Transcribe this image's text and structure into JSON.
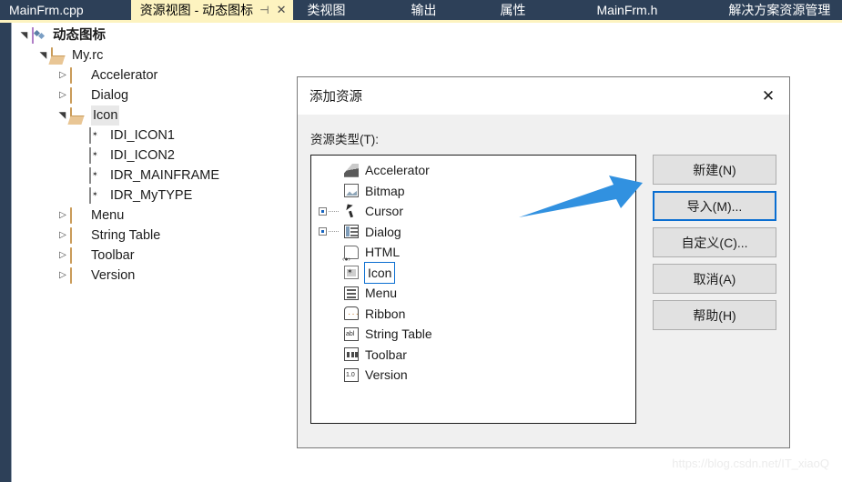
{
  "tabbar": {
    "tabs": [
      {
        "label": "MainFrm.cpp",
        "active": false
      },
      {
        "label": "资源视图 - 动态图标",
        "active": true
      },
      {
        "label": "类视图",
        "active": false
      },
      {
        "label": "输出",
        "active": false
      },
      {
        "label": "属性",
        "active": false
      },
      {
        "label": "MainFrm.h",
        "active": false
      },
      {
        "label": "解决方案资源管理",
        "active": false
      }
    ],
    "pin_glyph": "⊣",
    "close_glyph": "✕",
    "active_bg": "#fdf3c0",
    "bar_bg": "#2d4058"
  },
  "treeview": {
    "nodes": [
      {
        "label": "动态图标",
        "indent": 0,
        "twisty": "▲",
        "icon": "project-icon",
        "bold": true,
        "selected": false
      },
      {
        "label": "My.rc",
        "indent": 1,
        "twisty": "▲",
        "icon": "folder-open-icon",
        "bold": false,
        "selected": false
      },
      {
        "label": "Accelerator",
        "indent": 2,
        "twisty": "▷",
        "icon": "folder-icon",
        "bold": false,
        "selected": false
      },
      {
        "label": "Dialog",
        "indent": 2,
        "twisty": "▷",
        "icon": "folder-icon",
        "bold": false,
        "selected": false
      },
      {
        "label": "Icon",
        "indent": 2,
        "twisty": "▲",
        "icon": "folder-open-icon",
        "bold": false,
        "selected": true
      },
      {
        "label": "IDI_ICON1",
        "indent": 3,
        "twisty": "",
        "icon": "resource-file-icon",
        "bold": false,
        "selected": false
      },
      {
        "label": "IDI_ICON2",
        "indent": 3,
        "twisty": "",
        "icon": "resource-file-icon",
        "bold": false,
        "selected": false
      },
      {
        "label": "IDR_MAINFRAME",
        "indent": 3,
        "twisty": "",
        "icon": "resource-file-icon",
        "bold": false,
        "selected": false
      },
      {
        "label": "IDR_MyTYPE",
        "indent": 3,
        "twisty": "",
        "icon": "resource-file-icon",
        "bold": false,
        "selected": false
      },
      {
        "label": "Menu",
        "indent": 2,
        "twisty": "▷",
        "icon": "folder-icon",
        "bold": false,
        "selected": false
      },
      {
        "label": "String Table",
        "indent": 2,
        "twisty": "▷",
        "icon": "folder-icon",
        "bold": false,
        "selected": false
      },
      {
        "label": "Toolbar",
        "indent": 2,
        "twisty": "▷",
        "icon": "folder-icon",
        "bold": false,
        "selected": false
      },
      {
        "label": "Version",
        "indent": 2,
        "twisty": "▷",
        "icon": "folder-icon",
        "bold": false,
        "selected": false
      }
    ]
  },
  "dialog": {
    "title": "添加资源",
    "close_glyph": "✕",
    "list_label": "资源类型(T):",
    "items": [
      {
        "label": "Accelerator",
        "icon": "accelerator-icon",
        "expandable": false,
        "focused": false
      },
      {
        "label": "Bitmap",
        "icon": "bitmap-icon",
        "expandable": false,
        "focused": false
      },
      {
        "label": "Cursor",
        "icon": "cursor-icon",
        "expandable": true,
        "focused": false
      },
      {
        "label": "Dialog",
        "icon": "dialog-icon",
        "expandable": true,
        "focused": false
      },
      {
        "label": "HTML",
        "icon": "html-icon",
        "expandable": false,
        "focused": false
      },
      {
        "label": "Icon",
        "icon": "icon-icon",
        "expandable": false,
        "focused": true
      },
      {
        "label": "Menu",
        "icon": "menu-icon",
        "expandable": false,
        "focused": false
      },
      {
        "label": "Ribbon",
        "icon": "ribbon-icon",
        "expandable": false,
        "focused": false
      },
      {
        "label": "String Table",
        "icon": "string-table-icon",
        "expandable": false,
        "focused": false
      },
      {
        "label": "Toolbar",
        "icon": "toolbar-icon",
        "expandable": false,
        "focused": false
      },
      {
        "label": "Version",
        "icon": "version-icon",
        "expandable": false,
        "focused": false
      }
    ],
    "buttons": [
      {
        "label": "新建(N)",
        "focused": false
      },
      {
        "label": "导入(M)...",
        "focused": true
      },
      {
        "label": "自定义(C)...",
        "focused": false
      },
      {
        "label": "取消(A)",
        "focused": false
      },
      {
        "label": "帮助(H)",
        "focused": false
      }
    ]
  },
  "annotation": {
    "arrow_color": "#3191e0",
    "arrow_target": "导入(M)..."
  },
  "watermark": {
    "text": "https://blog.csdn.net/IT_xiaoQ"
  }
}
